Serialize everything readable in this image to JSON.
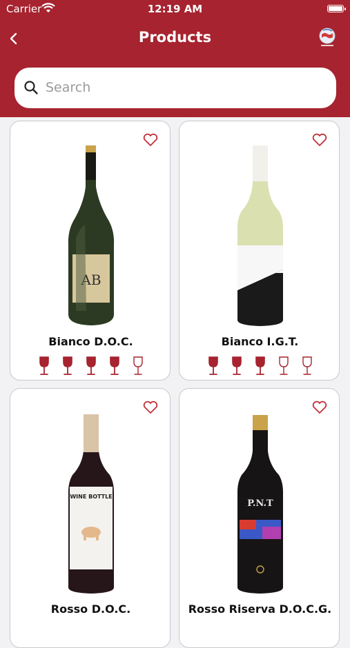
{
  "status_bar": {
    "carrier": "Carrier",
    "time": "12:19 AM"
  },
  "nav": {
    "title": "Products",
    "back_icon": "chevron-left-icon",
    "logo_icon": "globe-logo-icon"
  },
  "search": {
    "placeholder": "Search"
  },
  "colors": {
    "brand": "#a6232f",
    "rating": "#a6232f"
  },
  "products": [
    {
      "name": "Bianco D.O.C.",
      "rating": 4,
      "max_rating": 5
    },
    {
      "name": "Bianco I.G.T.",
      "rating": 3,
      "max_rating": 5
    },
    {
      "name": "Rosso D.O.C.",
      "rating": null,
      "max_rating": 5
    },
    {
      "name": "Rosso Riserva D.O.C.G.",
      "rating": null,
      "max_rating": 5
    }
  ]
}
